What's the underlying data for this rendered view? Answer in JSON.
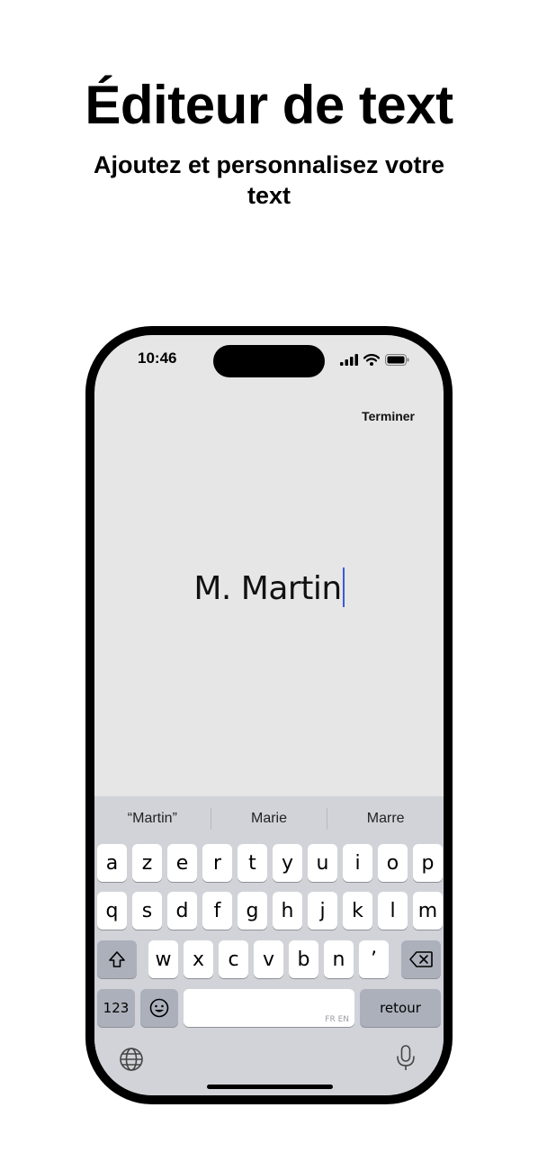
{
  "promo": {
    "title": "Éditeur de text",
    "subtitle": "Ajoutez et personnalisez votre text"
  },
  "status_bar": {
    "time": "10:46",
    "icons": [
      "signal-icon",
      "wifi-icon",
      "battery-icon"
    ]
  },
  "editor": {
    "done_label": "Terminer",
    "text": "M. Martin",
    "caret_color": "#3a5bd9"
  },
  "keyboard": {
    "suggestions": [
      "“Martin”",
      "Marie",
      "Marre"
    ],
    "row1": [
      "a",
      "z",
      "e",
      "r",
      "t",
      "y",
      "u",
      "i",
      "o",
      "p"
    ],
    "row2": [
      "q",
      "s",
      "d",
      "f",
      "g",
      "h",
      "j",
      "k",
      "l",
      "m"
    ],
    "row3": [
      "w",
      "x",
      "c",
      "v",
      "b",
      "n",
      "’"
    ],
    "numbers_label": "123",
    "space_tag": "FR EN",
    "return_label": "retour",
    "icons": [
      "shift-icon",
      "delete-icon",
      "emoji-icon",
      "globe-icon",
      "microphone-icon"
    ]
  },
  "colors": {
    "screen_bg": "#e6e6e7",
    "keyboard_bg": "#d1d3d9",
    "key_bg": "#ffffff",
    "dark_key_bg": "#abb0ba"
  }
}
